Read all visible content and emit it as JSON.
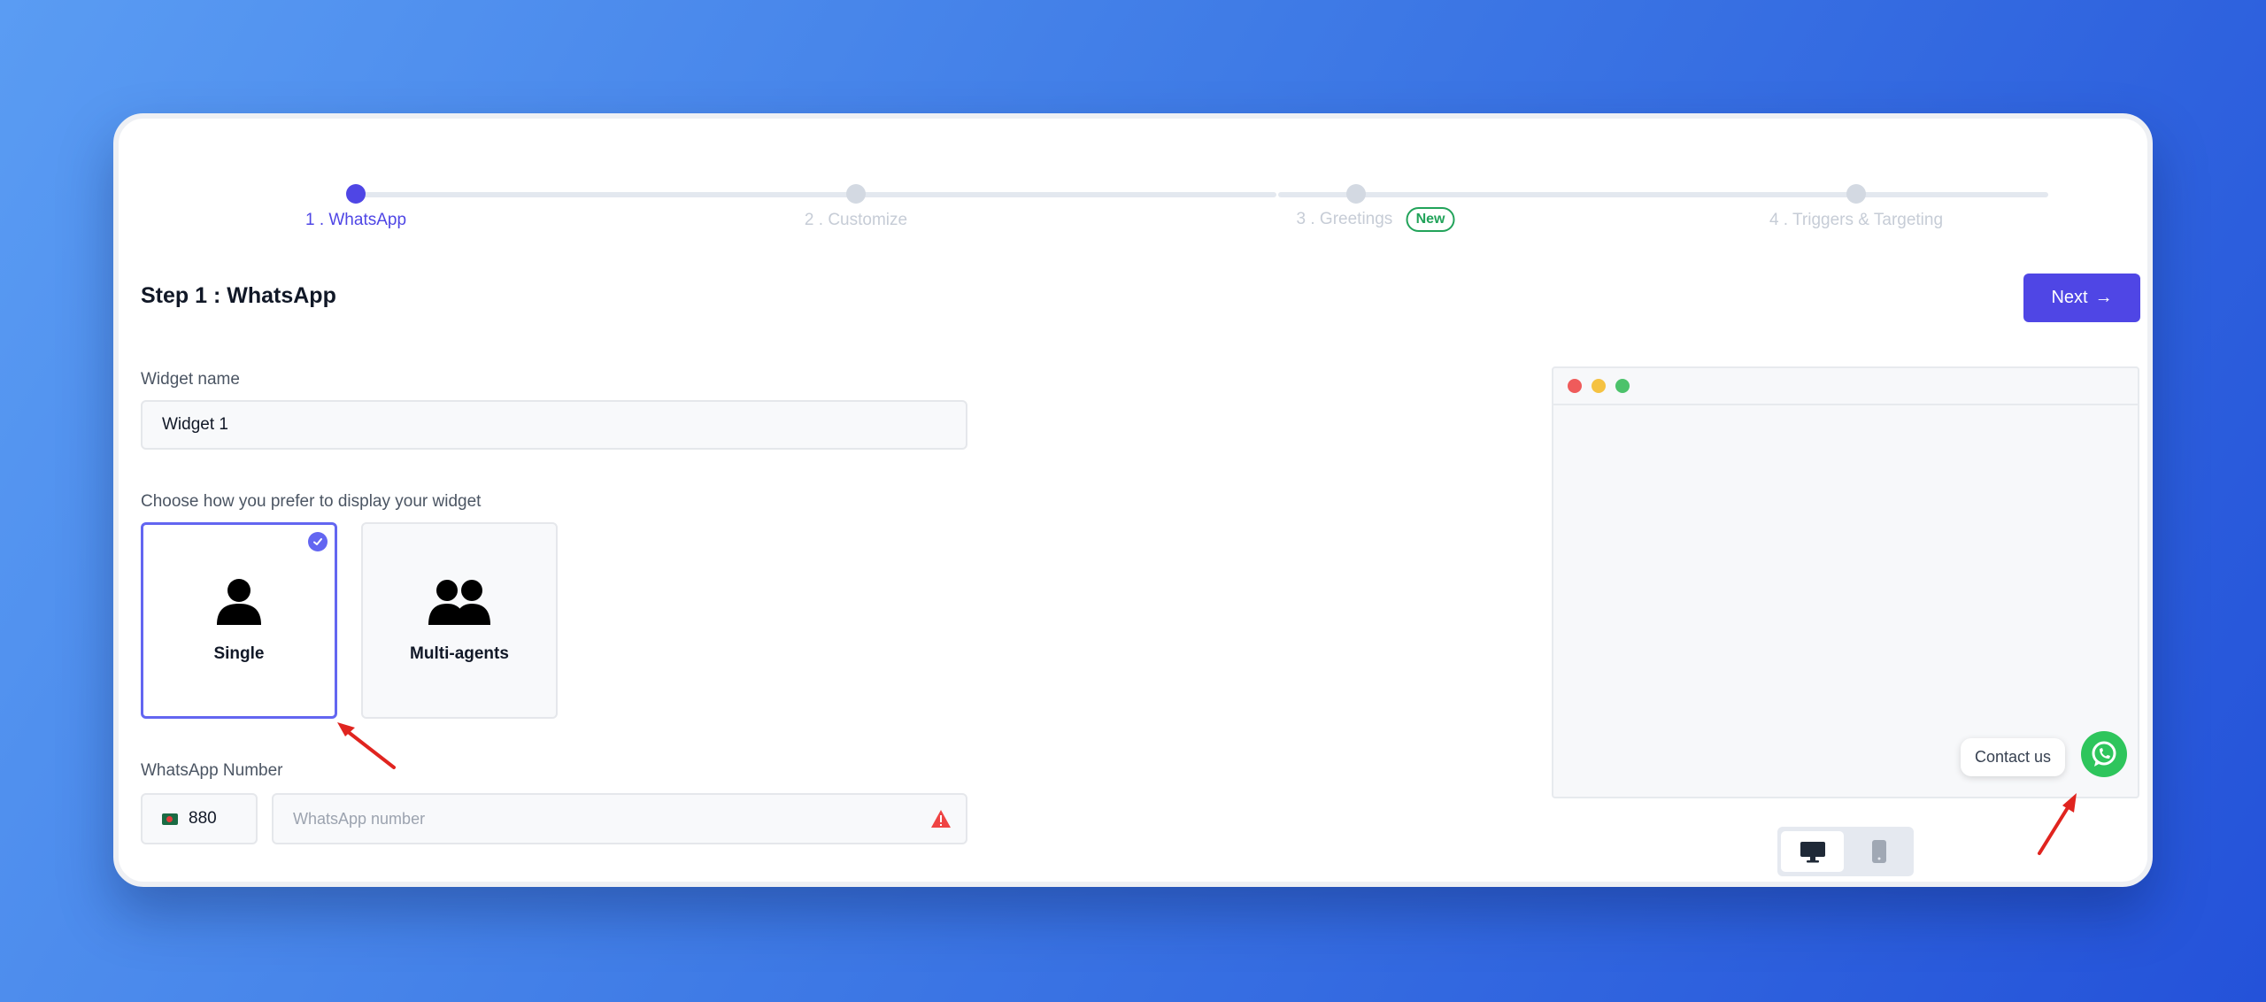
{
  "stepper": {
    "steps": [
      {
        "label": "1 . WhatsApp",
        "active": true
      },
      {
        "label": "2 . Customize",
        "active": false
      },
      {
        "label": "3 . Greetings",
        "active": false,
        "badge": "New"
      },
      {
        "label": "4 . Triggers & Targeting",
        "active": false
      }
    ]
  },
  "page": {
    "title": "Step 1 : WhatsApp",
    "next_label": "Next",
    "next_arrow": "→"
  },
  "widget_name": {
    "label": "Widget name",
    "value": "Widget 1"
  },
  "display_mode": {
    "label": "Choose how you prefer to display your widget",
    "options": [
      {
        "label": "Single",
        "selected": true,
        "icon": "user-icon"
      },
      {
        "label": "Multi-agents",
        "selected": false,
        "icon": "users-icon"
      }
    ]
  },
  "whatsapp_number": {
    "label": "WhatsApp Number",
    "country_code": "880",
    "country_flag": "bangladesh-flag-icon",
    "placeholder": "WhatsApp number",
    "status_icon": "warning-icon"
  },
  "preview": {
    "window_dots": [
      "#ef5b5b",
      "#f5c242",
      "#4cc26b"
    ],
    "contact_label": "Contact us",
    "device_modes": [
      {
        "name": "desktop",
        "active": true
      },
      {
        "name": "mobile",
        "active": false
      }
    ]
  },
  "colors": {
    "accent": "#4f46e5",
    "whatsapp_green": "#2ec55c",
    "new_badge": "#22a35a",
    "warning": "#ef4444",
    "annotation_arrow": "#e0241f"
  }
}
